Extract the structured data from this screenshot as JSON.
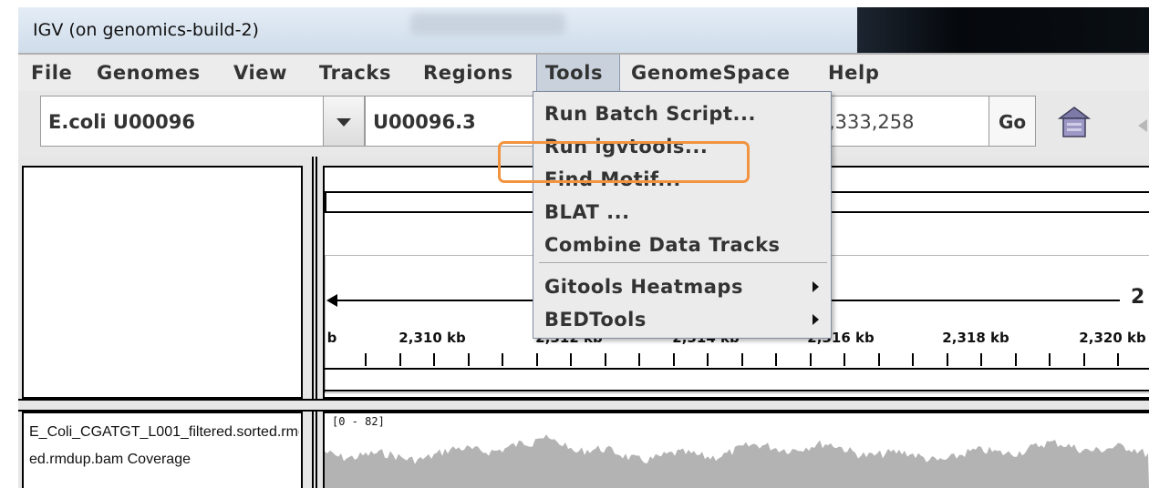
{
  "window": {
    "title": "IGV (on genomics-build-2)"
  },
  "menubar": {
    "items": [
      {
        "label": "File"
      },
      {
        "label": "Genomes"
      },
      {
        "label": "View"
      },
      {
        "label": "Tracks"
      },
      {
        "label": "Regions"
      },
      {
        "label": "Tools"
      },
      {
        "label": "GenomeSpace"
      },
      {
        "label": "Help"
      }
    ],
    "active": "Tools"
  },
  "toolbar": {
    "genome": "E.coli U00096",
    "chromosome": "U00096.3",
    "locus": ",333,258",
    "go_label": "Go"
  },
  "tools_menu": {
    "items": [
      {
        "label": "Run Batch Script..."
      },
      {
        "label": "Run igvtools..."
      },
      {
        "label": "Find Motif..."
      },
      {
        "label": "BLAT ..."
      },
      {
        "label": "Combine Data Tracks"
      },
      {
        "label": "Gitools Heatmaps"
      },
      {
        "label": "BEDTools"
      }
    ],
    "highlighted": "Run igvtools..."
  },
  "ruler": {
    "span_label": "2",
    "left_fragment": "b",
    "ticks": [
      "2,310 kb",
      "2,312 kb",
      "2,314 kb",
      "2,316 kb",
      "2,318 kb",
      "2,320 kb"
    ]
  },
  "tracks": [
    {
      "name_line1": "E_Coli_CGATGT_L001_filtered.sorted.rmdup.bam Coverage",
      "name_line2": "ed.rmdup.bam Coverage",
      "data_range": "[0 - 82]",
      "color": "#b3b3b3"
    }
  ],
  "colors": {
    "highlight": "#f2933f",
    "menu_active": "#c8d1dc"
  },
  "icons": [
    "home-icon",
    "back-arrow-icon",
    "dropdown-arrow-icon",
    "submenu-arrow-icon"
  ]
}
